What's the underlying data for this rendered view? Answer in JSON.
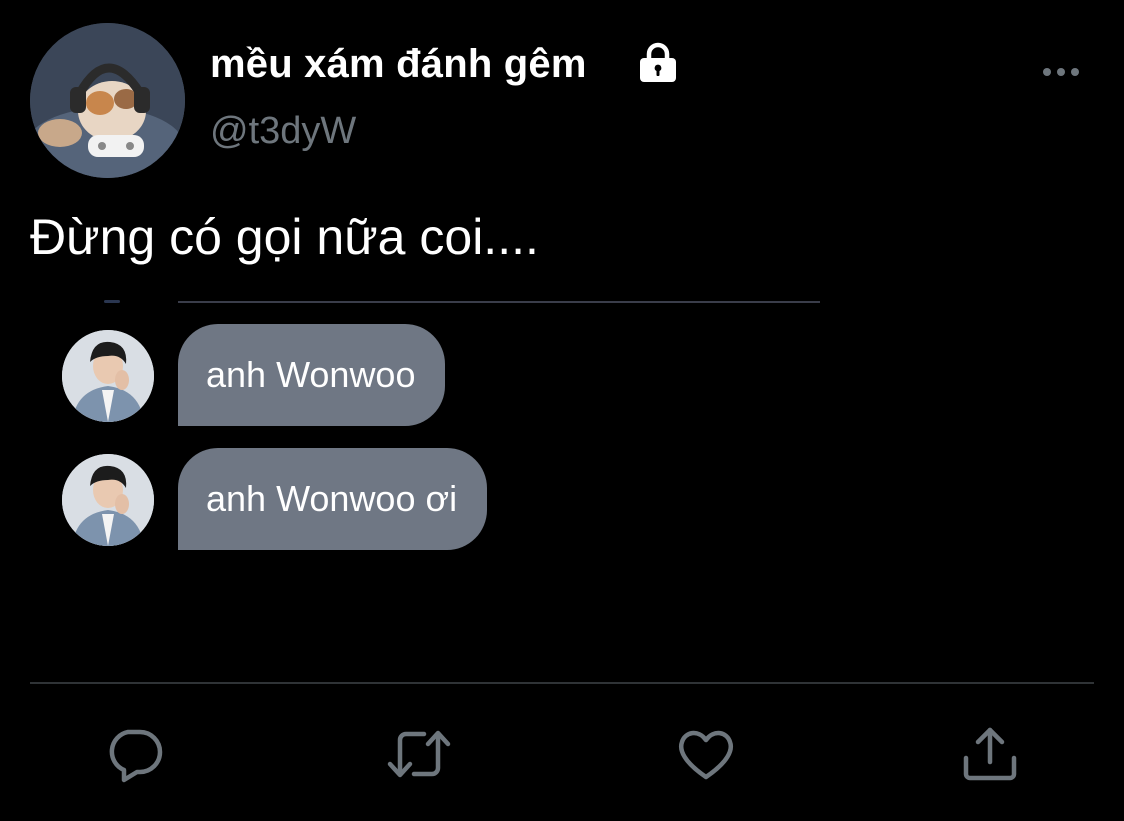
{
  "tweet": {
    "display_name": "mều xám đánh gêm",
    "handle": "@t3dyW",
    "protected_icon": "lock-icon",
    "more_icon": "more-horizontal-icon",
    "text": "Đừng có gọi nữa coi...."
  },
  "media": {
    "messages": [
      {
        "text": "anh Wonwoo"
      },
      {
        "text": "anh Wonwoo ơi"
      }
    ]
  },
  "actions": {
    "reply_icon": "reply-icon",
    "retweet_icon": "retweet-icon",
    "like_icon": "heart-icon",
    "share_icon": "share-icon"
  },
  "colors": {
    "background": "#000000",
    "primary_text": "#ffffff",
    "secondary_text": "#6e767d",
    "bubble": "#6f7784",
    "divider": "#2f3336"
  }
}
